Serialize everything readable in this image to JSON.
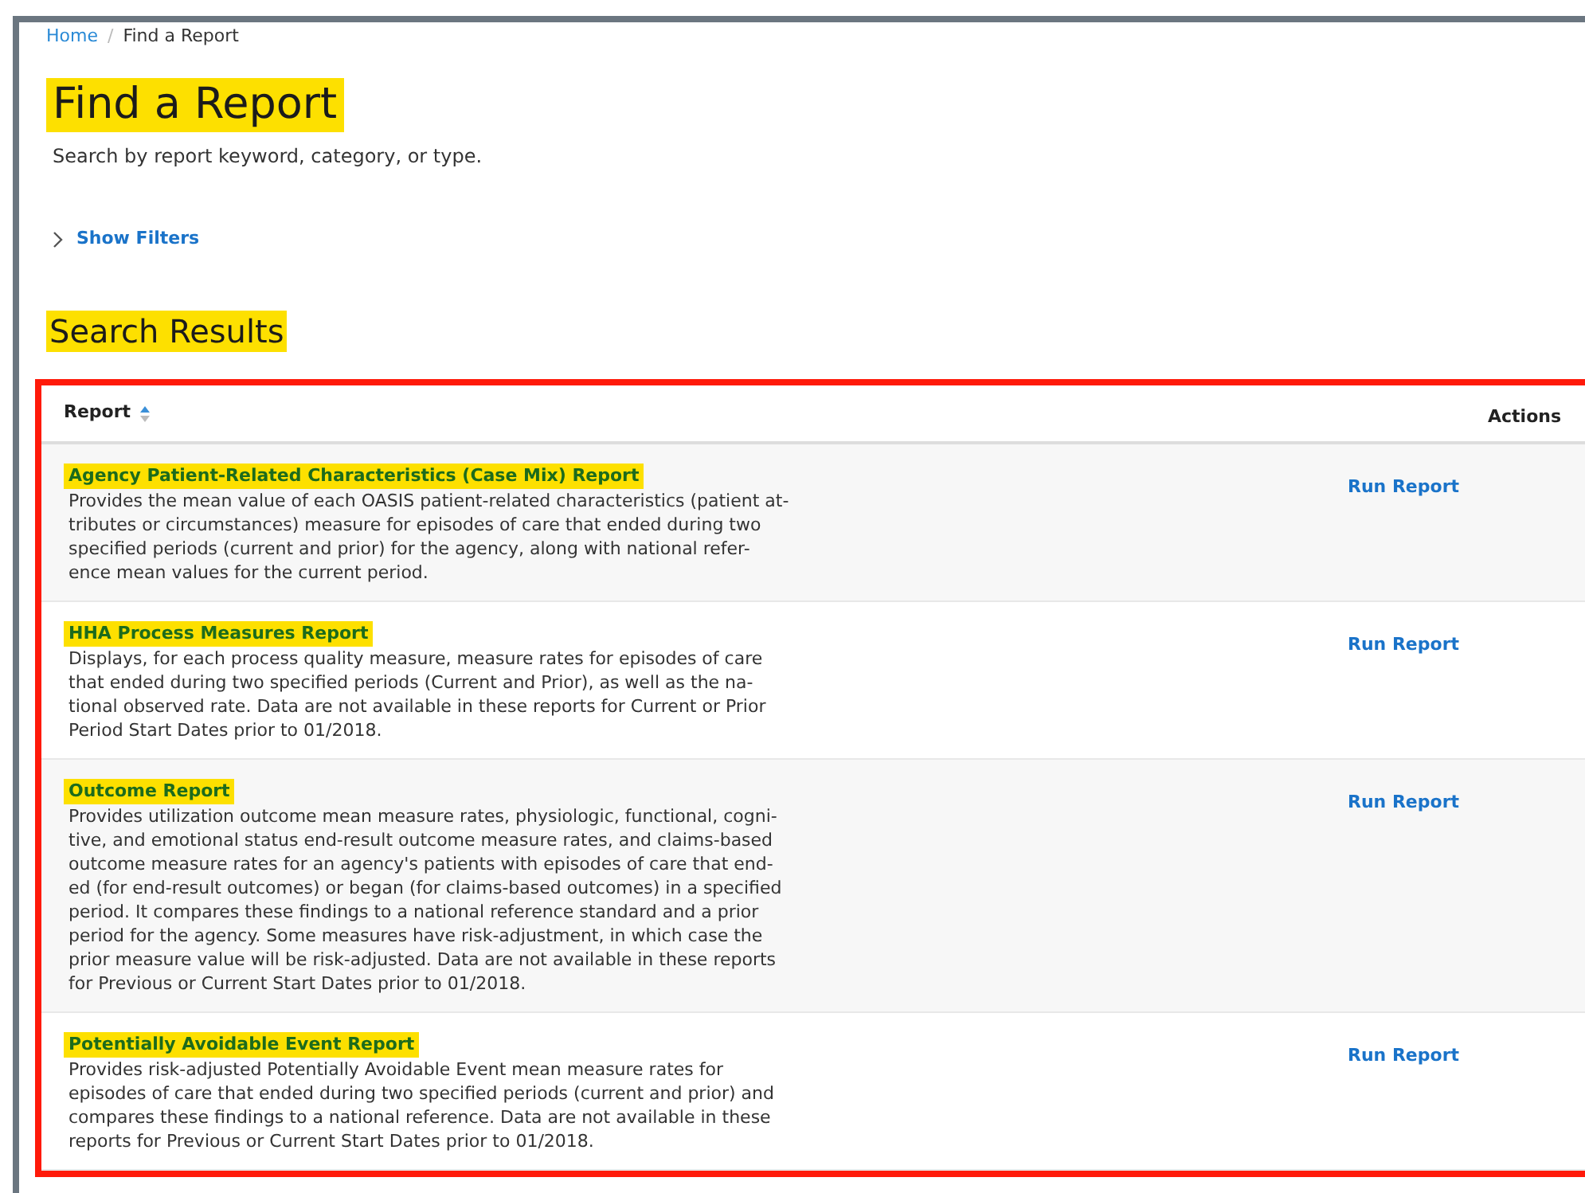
{
  "breadcrumb": [
    {
      "label": "Home",
      "link": true
    },
    {
      "label": "Find a Report",
      "link": false
    }
  ],
  "breadcrumb_separator": "/",
  "title": {
    "text": "Find a Report",
    "highlighted": true
  },
  "subtitle": "Search by report keyword, category, or type.",
  "filters_toggle": {
    "label": "Show Filters",
    "expanded": false
  },
  "results_heading": {
    "text": "Search Results",
    "highlighted": true
  },
  "table": {
    "outlined": true,
    "columns": [
      {
        "label": "Report",
        "sorted": true
      },
      {
        "label": "Actions",
        "sorted": false
      }
    ],
    "rows": [
      {
        "title": "Agency Patient-Related Characteristics (Case Mix) Report",
        "highlighted": true,
        "description": [
          "Provides the mean value of each OASIS patient-related characteristics (patient at-",
          "tributes or circumstances) measure for episodes of care that ended during two",
          "specified periods (current and prior) for the agency, along with national refer-",
          "ence mean values for the current period."
        ],
        "action": "Run Report"
      },
      {
        "title": "HHA Process Measures Report",
        "highlighted": true,
        "description": [
          "Displays, for each process quality measure, measure rates for episodes of care",
          "that ended during two specified periods (Current and Prior), as well as the na-",
          "tional observed rate. Data are not available in these reports for Current or Prior",
          "Period Start Dates prior to 01/2018."
        ],
        "action": "Run Report"
      },
      {
        "title": "Outcome Report",
        "highlighted": true,
        "description": [
          "Provides utilization outcome mean measure rates, physiologic, functional, cogni-",
          "tive, and emotional status end-result outcome measure rates, and claims-based",
          "outcome measure rates for an agency's patients with episodes of care that end-",
          "ed (for end-result outcomes) or began (for claims-based outcomes) in a specified",
          "period. It compares these findings to a national reference standard and a prior",
          "period for the agency. Some measures have risk-adjustment, in which case the",
          "prior measure value will be risk-adjusted. Data are not available in these reports",
          "for Previous or Current Start Dates prior to 01/2018."
        ],
        "action": "Run Report"
      },
      {
        "title": "Potentially Avoidable Event Report",
        "highlighted": true,
        "description": [
          "Provides risk-adjusted Potentially Avoidable Event mean measure rates for",
          "episodes of care that ended during two specified periods (current and prior) and",
          "compares these findings to a national reference. Data are not available in these",
          "reports for Previous or Current Start Dates prior to 01/2018."
        ],
        "action": "Run Report"
      }
    ]
  }
}
